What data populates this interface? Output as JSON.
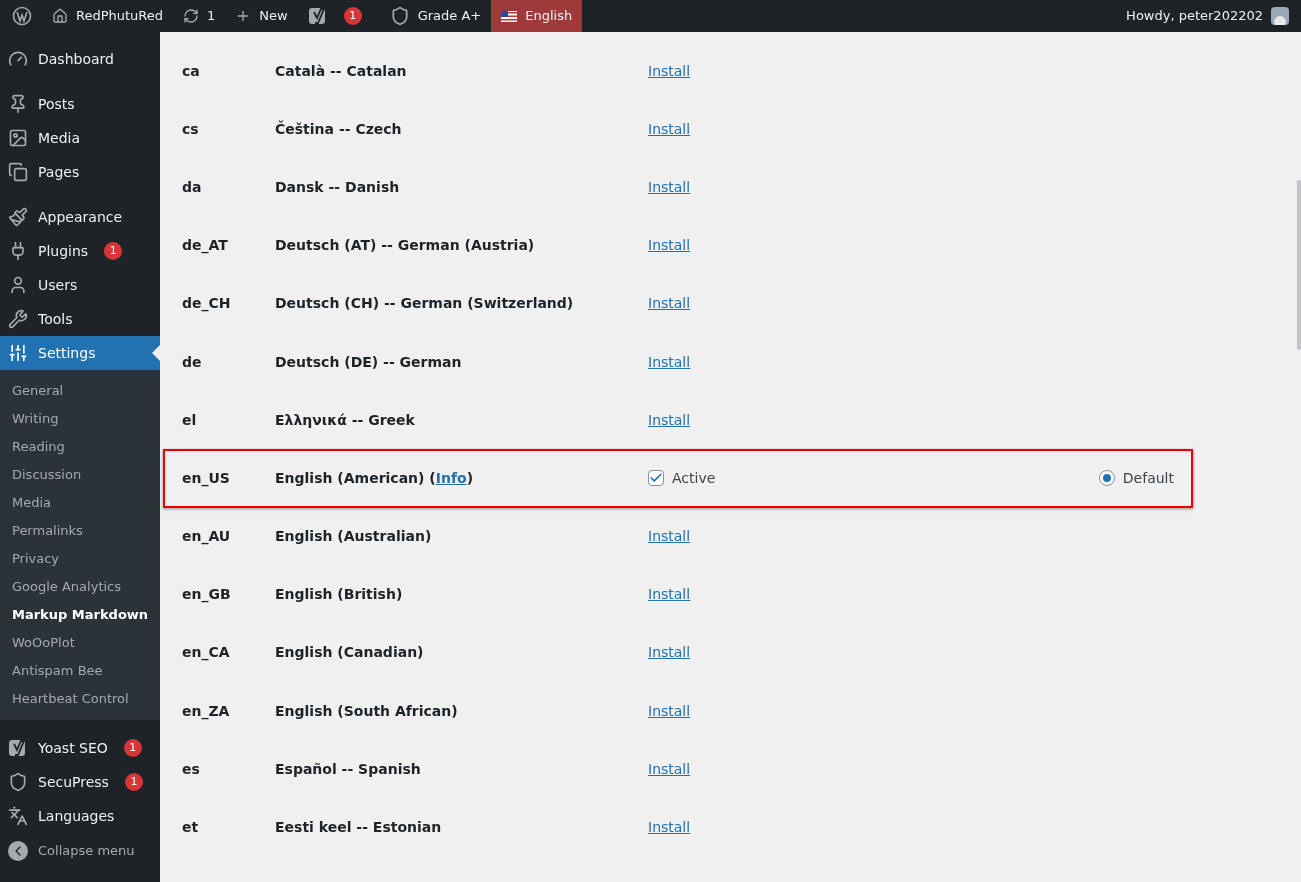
{
  "admin_bar": {
    "items": [
      {
        "kind": "logo"
      },
      {
        "kind": "home",
        "label": "RedPhutuRed"
      },
      {
        "kind": "updates",
        "label": "1"
      },
      {
        "kind": "new",
        "label": "New"
      },
      {
        "kind": "yoast",
        "badge": "1"
      },
      {
        "kind": "shield",
        "label": "Grade A+"
      },
      {
        "kind": "flag",
        "label": "English",
        "selected": true
      }
    ],
    "greeting": "Howdy, peter202202"
  },
  "sidebar": {
    "items": [
      {
        "kind": "dashboard",
        "label": "Dashboard",
        "selected": false
      },
      {
        "kind": "pin",
        "label": "Posts",
        "selected": false,
        "gap_before": true
      },
      {
        "kind": "media",
        "label": "Media",
        "selected": false
      },
      {
        "kind": "pages",
        "label": "Pages",
        "selected": false
      },
      {
        "kind": "brush",
        "label": "Appearance",
        "selected": false,
        "gap_before": true
      },
      {
        "kind": "plug",
        "label": "Plugins",
        "selected": false,
        "badge": "1"
      },
      {
        "kind": "user",
        "label": "Users",
        "selected": false
      },
      {
        "kind": "wrench",
        "label": "Tools",
        "selected": false
      },
      {
        "kind": "sliders",
        "label": "Settings",
        "selected": true,
        "children": [
          {
            "label": "General",
            "selected": false
          },
          {
            "label": "Writing",
            "selected": false
          },
          {
            "label": "Reading",
            "selected": false
          },
          {
            "label": "Discussion",
            "selected": false
          },
          {
            "label": "Media",
            "selected": false
          },
          {
            "label": "Permalinks",
            "selected": false
          },
          {
            "label": "Privacy",
            "selected": false
          },
          {
            "label": "Google Analytics",
            "selected": false
          },
          {
            "label": "Markup Markdown",
            "selected": true
          },
          {
            "label": "WoOoPlot",
            "selected": false
          },
          {
            "label": "Antispam Bee",
            "selected": false
          },
          {
            "label": "Heartbeat Control",
            "selected": false
          }
        ]
      },
      {
        "kind": "yoast",
        "label": "Yoast SEO",
        "selected": false,
        "badge": "1",
        "gap_before": true
      },
      {
        "kind": "shield",
        "label": "SecuPress",
        "selected": false,
        "badge": "1"
      },
      {
        "kind": "languages",
        "label": "Languages",
        "selected": false
      }
    ],
    "collapse": "Collapse menu"
  },
  "languages": [
    {
      "code": "ca",
      "name": "Català -- Catalan",
      "kind": "install",
      "action": "Install"
    },
    {
      "code": "cs",
      "name": "Čeština -- Czech",
      "kind": "install",
      "action": "Install"
    },
    {
      "code": "da",
      "name": "Dansk -- Danish",
      "kind": "install",
      "action": "Install"
    },
    {
      "code": "de_AT",
      "name": "Deutsch (AT) -- German (Austria)",
      "kind": "install",
      "action": "Install"
    },
    {
      "code": "de_CH",
      "name": "Deutsch (CH) -- German (Switzerland)",
      "kind": "install",
      "action": "Install"
    },
    {
      "code": "de",
      "name": "Deutsch (DE) -- German",
      "kind": "install",
      "action": "Install"
    },
    {
      "code": "el",
      "name": "Ελληνικά -- Greek",
      "kind": "install",
      "action": "Install"
    },
    {
      "code": "en_US",
      "name": "English (American) (",
      "info": "Info",
      "name_end": ")",
      "kind": "active",
      "active_label": "Active",
      "active": true,
      "default_label": "Default",
      "default": true,
      "highlighted": true
    },
    {
      "code": "en_AU",
      "name": "English (Australian)",
      "kind": "install",
      "action": "Install"
    },
    {
      "code": "en_GB",
      "name": "English (British)",
      "kind": "install",
      "action": "Install"
    },
    {
      "code": "en_CA",
      "name": "English (Canadian)",
      "kind": "install",
      "action": "Install"
    },
    {
      "code": "en_ZA",
      "name": "English (South African)",
      "kind": "install",
      "action": "Install"
    },
    {
      "code": "es",
      "name": "Español -- Spanish",
      "kind": "install",
      "action": "Install"
    },
    {
      "code": "et",
      "name": "Eesti keel -- Estonian",
      "kind": "install",
      "action": "Install"
    }
  ]
}
